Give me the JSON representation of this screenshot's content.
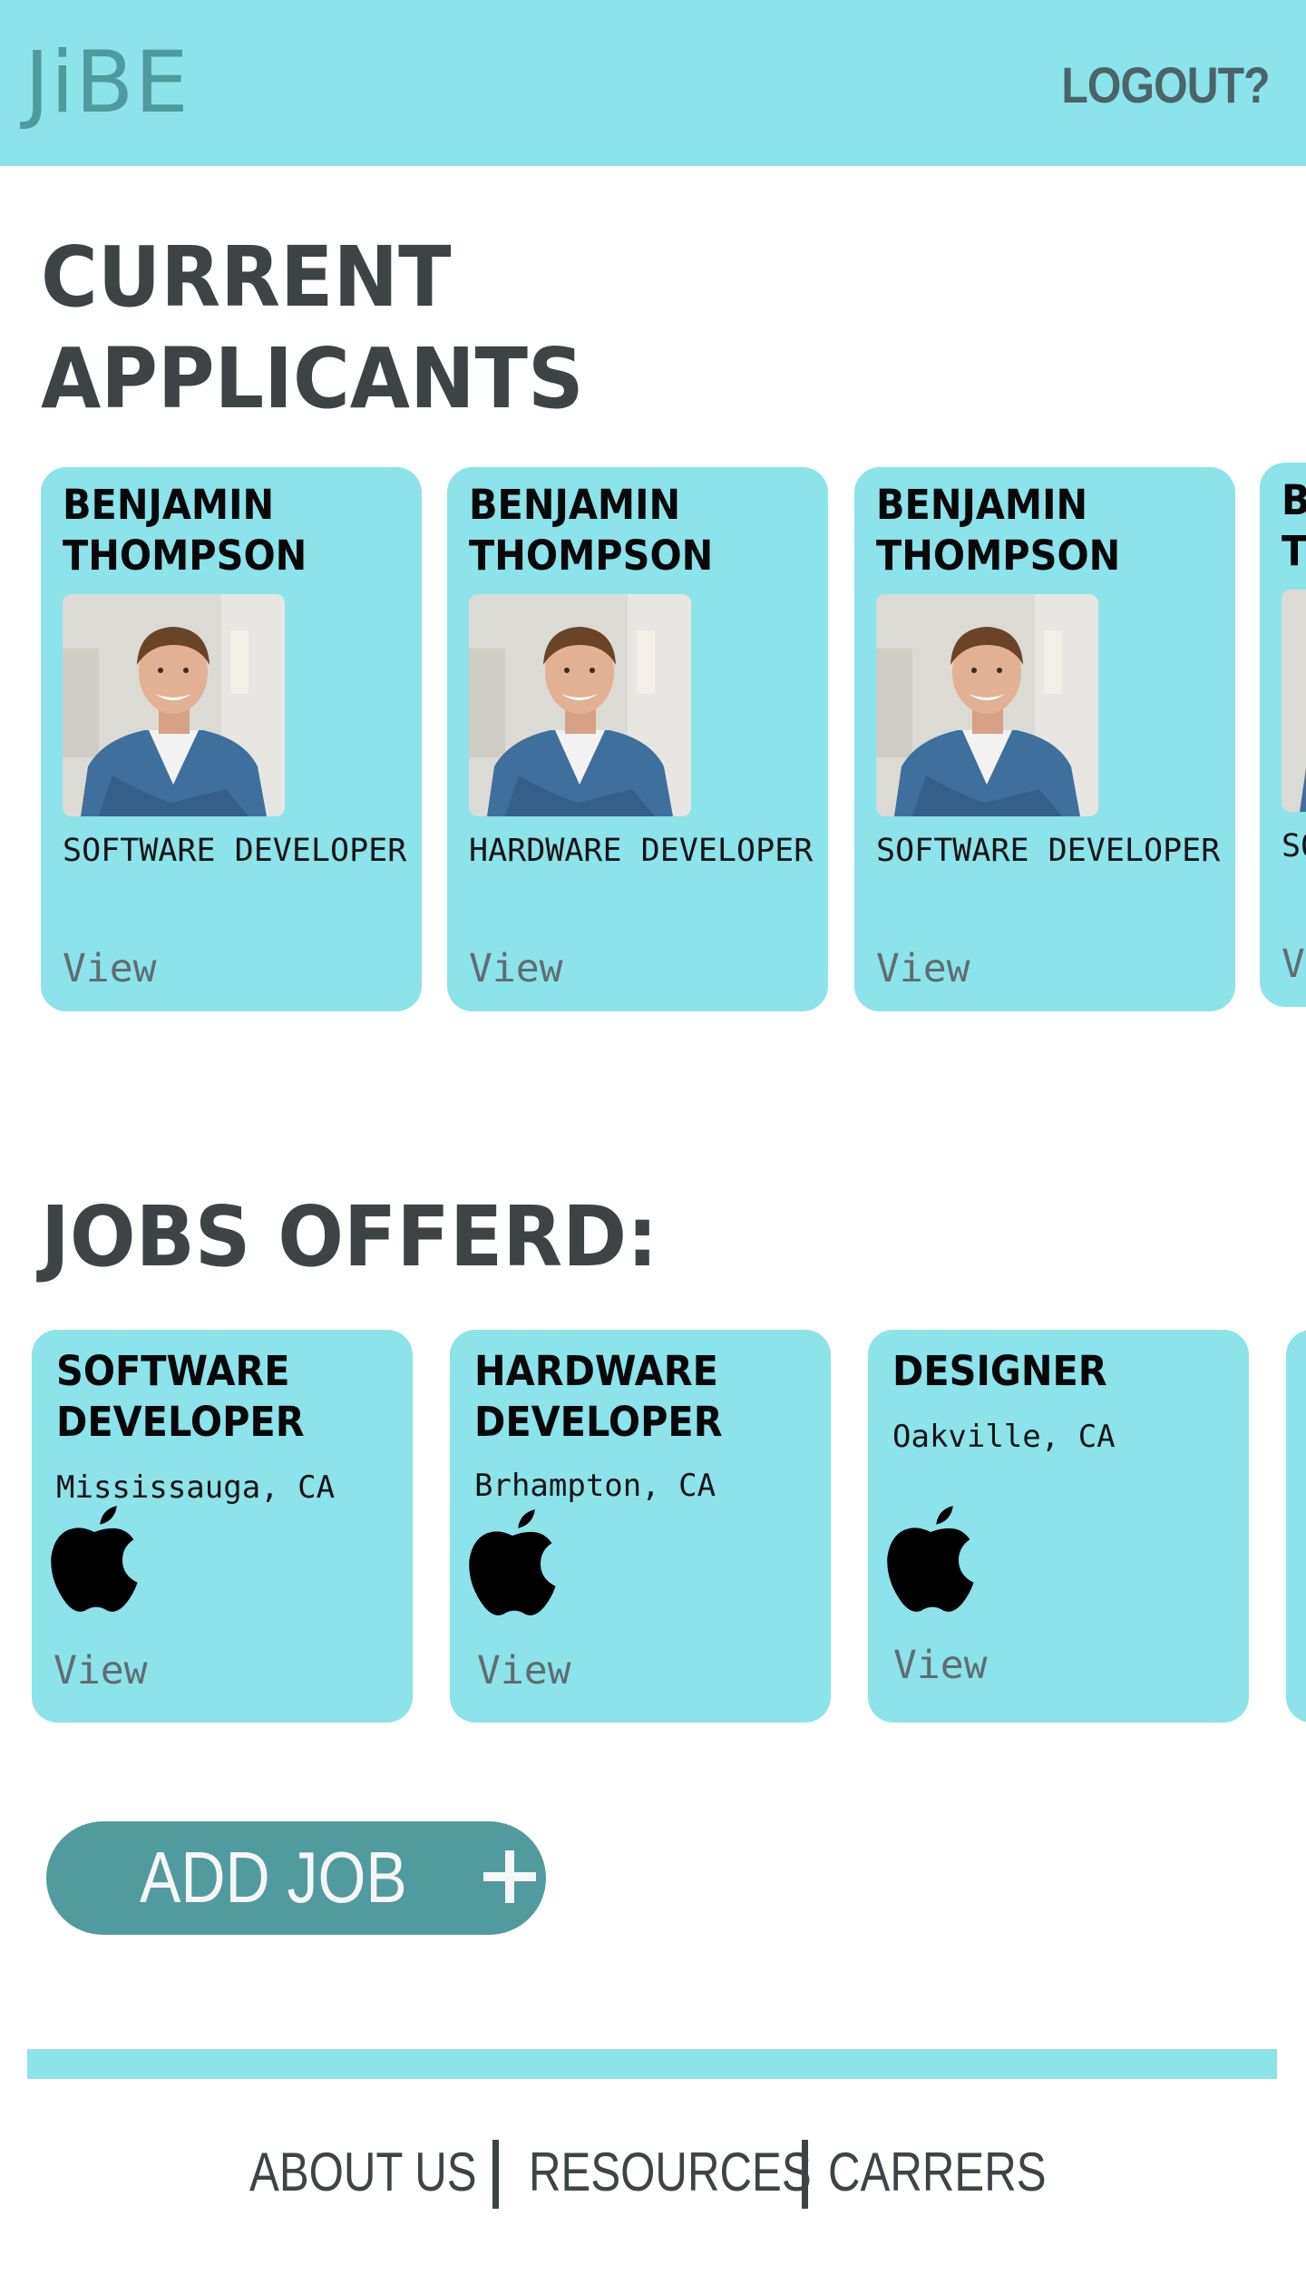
{
  "header": {
    "logo": "JiBE",
    "logout_label": "LOGOUT?"
  },
  "applicants": {
    "title": "CURRENT APPLICANTS",
    "cards": [
      {
        "name": "BENJAMIN THOMPSON",
        "role": "SOFTWARE DEVELOPER",
        "view_label": "View"
      },
      {
        "name": "BENJAMIN THOMPSON",
        "role": "HARDWARE DEVELOPER",
        "view_label": "View"
      },
      {
        "name": "BENJAMIN THOMPSON",
        "role": "SOFTWARE DEVELOPER",
        "view_label": "View"
      },
      {
        "name": "BENJAMIN THOMPSON",
        "role": "SOFTWARE DEVELOPER",
        "view_label": "View"
      }
    ]
  },
  "jobs": {
    "title": "JOBS OFFERD:",
    "cards": [
      {
        "title": "SOFTWARE DEVELOPER",
        "location": "Mississauga, CA",
        "logo_icon": "apple-icon",
        "view_label": "View"
      },
      {
        "title": "HARDWARE DEVELOPER",
        "location": "Brhampton, CA",
        "logo_icon": "apple-icon",
        "view_label": "View"
      },
      {
        "title": "DESIGNER",
        "location": "Oakville, CA",
        "logo_icon": "apple-icon",
        "view_label": "View"
      },
      {
        "title": ""
      }
    ]
  },
  "add_job": {
    "label": "ADD JOB",
    "icon": "plus-icon"
  },
  "footer": {
    "links": [
      "ABOUT US",
      "RESOURCES",
      "CARRERS"
    ]
  },
  "colors": {
    "accent": "#8ce3e9",
    "button": "#519b9e",
    "logo": "#4f9a9d",
    "heading": "#3e4446"
  }
}
